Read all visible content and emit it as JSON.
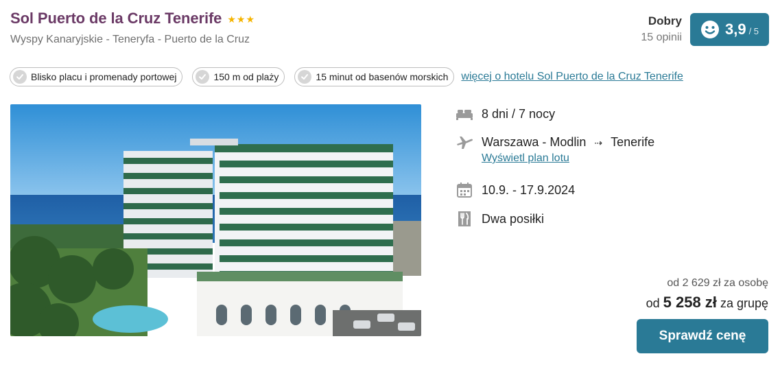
{
  "hotel": {
    "name": "Sol Puerto de la Cruz Tenerife",
    "stars": 3,
    "location": "Wyspy Kanaryjskie - Teneryfa - Puerto de la Cruz"
  },
  "rating": {
    "label": "Dobry",
    "count": "15 opinii",
    "score": "3,9",
    "max": "/ 5"
  },
  "tags": [
    {
      "label": "Blisko placu i promenady portowej"
    },
    {
      "label": "150 m od plaży"
    },
    {
      "label": "15 minut od basenów morskich"
    }
  ],
  "more_link": "więcej o hotelu Sol Puerto de la Cruz Tenerife",
  "details": {
    "duration": "8 dni / 7 nocy",
    "from": "Warszawa - Modlin",
    "arrow": "⇢",
    "to": "Tenerife",
    "flight_plan_link": "Wyświetl plan lotu",
    "dates": "10.9. - 17.9.2024",
    "board": "Dwa posiłki"
  },
  "price": {
    "per_person": "od 2 629 zł za osobę",
    "group_prefix": "od",
    "group_amount": "5 258 zł",
    "group_suffix": "za grupę"
  },
  "cta": "Sprawdź cenę",
  "colors": {
    "brand": "#2a7a96",
    "title": "#6b3a66",
    "star": "#f5b400"
  }
}
